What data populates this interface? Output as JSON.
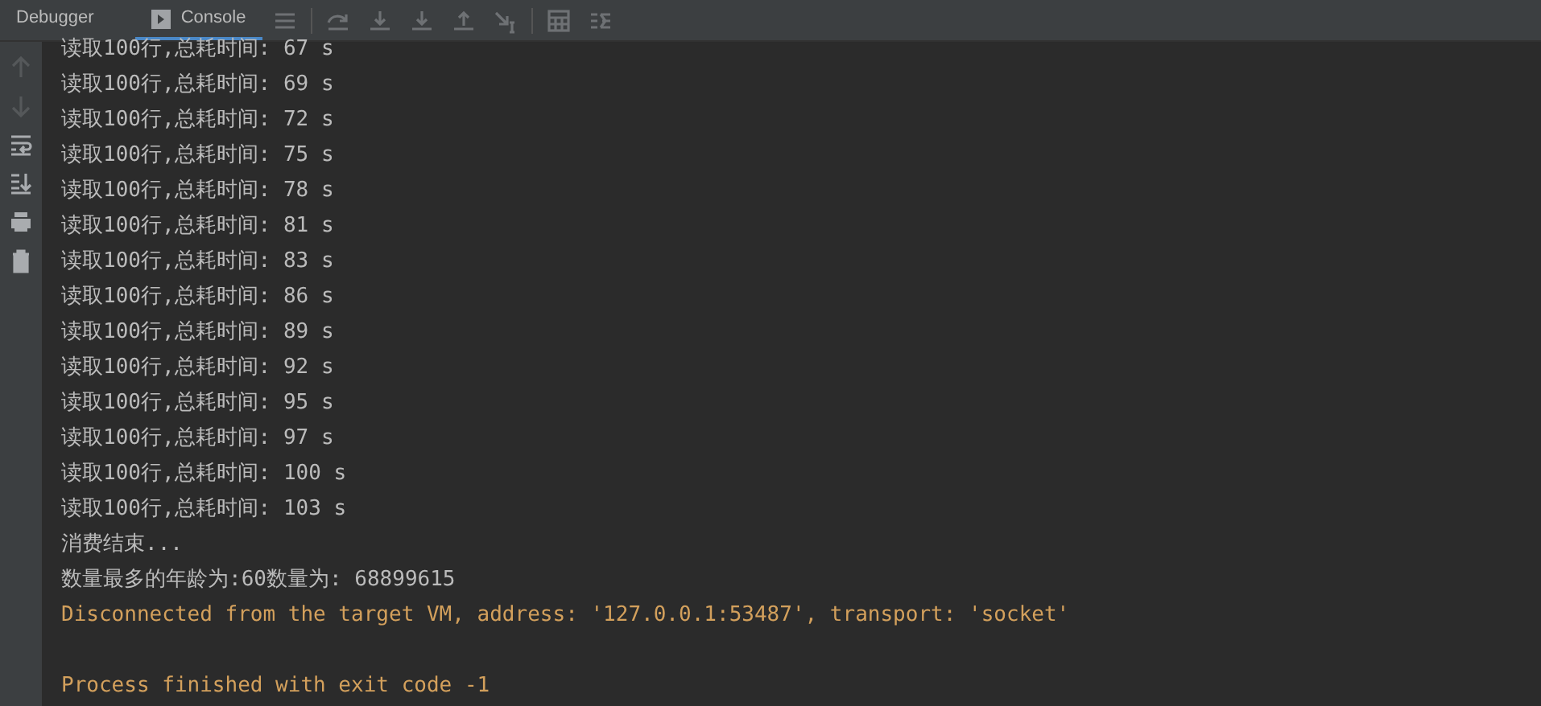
{
  "tabs": [
    {
      "label": "Debugger",
      "selected": false
    },
    {
      "label": "Console",
      "selected": true
    }
  ],
  "console_lines": [
    {
      "kind": "output",
      "text": "读取100行,总耗时间: 67 s"
    },
    {
      "kind": "output",
      "text": "读取100行,总耗时间: 69 s"
    },
    {
      "kind": "output",
      "text": "读取100行,总耗时间: 72 s"
    },
    {
      "kind": "output",
      "text": "读取100行,总耗时间: 75 s"
    },
    {
      "kind": "output",
      "text": "读取100行,总耗时间: 78 s"
    },
    {
      "kind": "output",
      "text": "读取100行,总耗时间: 81 s"
    },
    {
      "kind": "output",
      "text": "读取100行,总耗时间: 83 s"
    },
    {
      "kind": "output",
      "text": "读取100行,总耗时间: 86 s"
    },
    {
      "kind": "output",
      "text": "读取100行,总耗时间: 89 s"
    },
    {
      "kind": "output",
      "text": "读取100行,总耗时间: 92 s"
    },
    {
      "kind": "output",
      "text": "读取100行,总耗时间: 95 s"
    },
    {
      "kind": "output",
      "text": "读取100行,总耗时间: 97 s"
    },
    {
      "kind": "output",
      "text": "读取100行,总耗时间: 100 s"
    },
    {
      "kind": "output",
      "text": "读取100行,总耗时间: 103 s"
    },
    {
      "kind": "output",
      "text": "消费结束..."
    },
    {
      "kind": "output",
      "text": "数量最多的年龄为:60数量为: 68899615"
    },
    {
      "kind": "system",
      "text": "Disconnected from the target VM, address: '127.0.0.1:53487', transport: 'socket'"
    },
    {
      "kind": "blank"
    },
    {
      "kind": "system",
      "text": "Process finished with exit code -1"
    }
  ]
}
